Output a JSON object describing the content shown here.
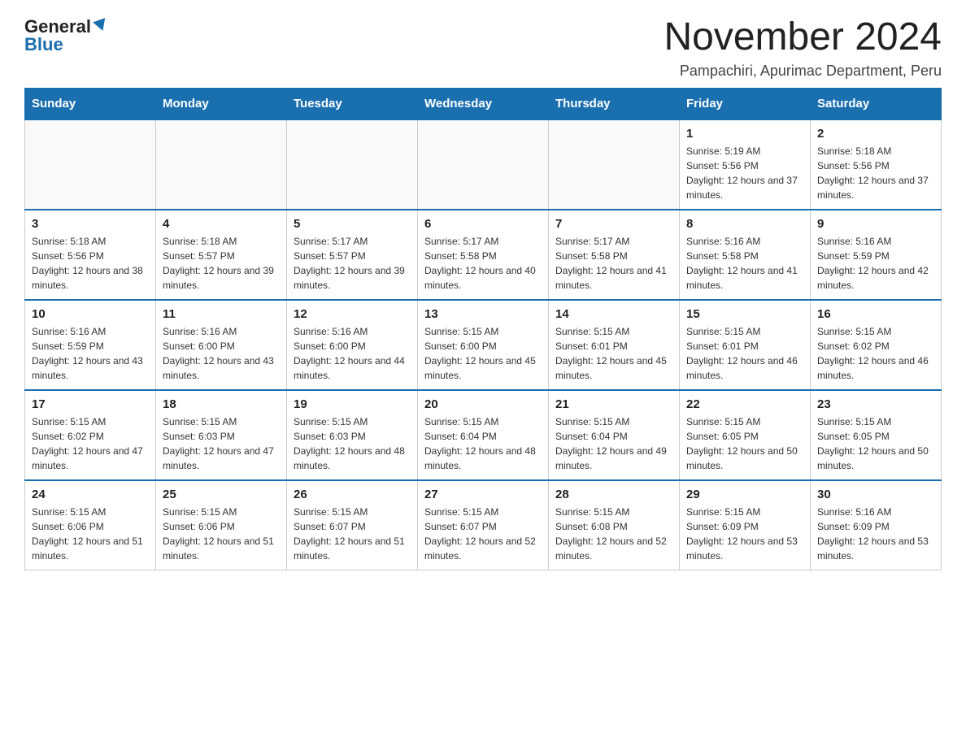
{
  "logo": {
    "general": "General",
    "blue": "Blue"
  },
  "title": "November 2024",
  "subtitle": "Pampachiri, Apurimac Department, Peru",
  "weekdays": [
    "Sunday",
    "Monday",
    "Tuesday",
    "Wednesday",
    "Thursday",
    "Friday",
    "Saturday"
  ],
  "weeks": [
    [
      {
        "day": "",
        "sunrise": "",
        "sunset": "",
        "daylight": ""
      },
      {
        "day": "",
        "sunrise": "",
        "sunset": "",
        "daylight": ""
      },
      {
        "day": "",
        "sunrise": "",
        "sunset": "",
        "daylight": ""
      },
      {
        "day": "",
        "sunrise": "",
        "sunset": "",
        "daylight": ""
      },
      {
        "day": "",
        "sunrise": "",
        "sunset": "",
        "daylight": ""
      },
      {
        "day": "1",
        "sunrise": "Sunrise: 5:19 AM",
        "sunset": "Sunset: 5:56 PM",
        "daylight": "Daylight: 12 hours and 37 minutes."
      },
      {
        "day": "2",
        "sunrise": "Sunrise: 5:18 AM",
        "sunset": "Sunset: 5:56 PM",
        "daylight": "Daylight: 12 hours and 37 minutes."
      }
    ],
    [
      {
        "day": "3",
        "sunrise": "Sunrise: 5:18 AM",
        "sunset": "Sunset: 5:56 PM",
        "daylight": "Daylight: 12 hours and 38 minutes."
      },
      {
        "day": "4",
        "sunrise": "Sunrise: 5:18 AM",
        "sunset": "Sunset: 5:57 PM",
        "daylight": "Daylight: 12 hours and 39 minutes."
      },
      {
        "day": "5",
        "sunrise": "Sunrise: 5:17 AM",
        "sunset": "Sunset: 5:57 PM",
        "daylight": "Daylight: 12 hours and 39 minutes."
      },
      {
        "day": "6",
        "sunrise": "Sunrise: 5:17 AM",
        "sunset": "Sunset: 5:58 PM",
        "daylight": "Daylight: 12 hours and 40 minutes."
      },
      {
        "day": "7",
        "sunrise": "Sunrise: 5:17 AM",
        "sunset": "Sunset: 5:58 PM",
        "daylight": "Daylight: 12 hours and 41 minutes."
      },
      {
        "day": "8",
        "sunrise": "Sunrise: 5:16 AM",
        "sunset": "Sunset: 5:58 PM",
        "daylight": "Daylight: 12 hours and 41 minutes."
      },
      {
        "day": "9",
        "sunrise": "Sunrise: 5:16 AM",
        "sunset": "Sunset: 5:59 PM",
        "daylight": "Daylight: 12 hours and 42 minutes."
      }
    ],
    [
      {
        "day": "10",
        "sunrise": "Sunrise: 5:16 AM",
        "sunset": "Sunset: 5:59 PM",
        "daylight": "Daylight: 12 hours and 43 minutes."
      },
      {
        "day": "11",
        "sunrise": "Sunrise: 5:16 AM",
        "sunset": "Sunset: 6:00 PM",
        "daylight": "Daylight: 12 hours and 43 minutes."
      },
      {
        "day": "12",
        "sunrise": "Sunrise: 5:16 AM",
        "sunset": "Sunset: 6:00 PM",
        "daylight": "Daylight: 12 hours and 44 minutes."
      },
      {
        "day": "13",
        "sunrise": "Sunrise: 5:15 AM",
        "sunset": "Sunset: 6:00 PM",
        "daylight": "Daylight: 12 hours and 45 minutes."
      },
      {
        "day": "14",
        "sunrise": "Sunrise: 5:15 AM",
        "sunset": "Sunset: 6:01 PM",
        "daylight": "Daylight: 12 hours and 45 minutes."
      },
      {
        "day": "15",
        "sunrise": "Sunrise: 5:15 AM",
        "sunset": "Sunset: 6:01 PM",
        "daylight": "Daylight: 12 hours and 46 minutes."
      },
      {
        "day": "16",
        "sunrise": "Sunrise: 5:15 AM",
        "sunset": "Sunset: 6:02 PM",
        "daylight": "Daylight: 12 hours and 46 minutes."
      }
    ],
    [
      {
        "day": "17",
        "sunrise": "Sunrise: 5:15 AM",
        "sunset": "Sunset: 6:02 PM",
        "daylight": "Daylight: 12 hours and 47 minutes."
      },
      {
        "day": "18",
        "sunrise": "Sunrise: 5:15 AM",
        "sunset": "Sunset: 6:03 PM",
        "daylight": "Daylight: 12 hours and 47 minutes."
      },
      {
        "day": "19",
        "sunrise": "Sunrise: 5:15 AM",
        "sunset": "Sunset: 6:03 PM",
        "daylight": "Daylight: 12 hours and 48 minutes."
      },
      {
        "day": "20",
        "sunrise": "Sunrise: 5:15 AM",
        "sunset": "Sunset: 6:04 PM",
        "daylight": "Daylight: 12 hours and 48 minutes."
      },
      {
        "day": "21",
        "sunrise": "Sunrise: 5:15 AM",
        "sunset": "Sunset: 6:04 PM",
        "daylight": "Daylight: 12 hours and 49 minutes."
      },
      {
        "day": "22",
        "sunrise": "Sunrise: 5:15 AM",
        "sunset": "Sunset: 6:05 PM",
        "daylight": "Daylight: 12 hours and 50 minutes."
      },
      {
        "day": "23",
        "sunrise": "Sunrise: 5:15 AM",
        "sunset": "Sunset: 6:05 PM",
        "daylight": "Daylight: 12 hours and 50 minutes."
      }
    ],
    [
      {
        "day": "24",
        "sunrise": "Sunrise: 5:15 AM",
        "sunset": "Sunset: 6:06 PM",
        "daylight": "Daylight: 12 hours and 51 minutes."
      },
      {
        "day": "25",
        "sunrise": "Sunrise: 5:15 AM",
        "sunset": "Sunset: 6:06 PM",
        "daylight": "Daylight: 12 hours and 51 minutes."
      },
      {
        "day": "26",
        "sunrise": "Sunrise: 5:15 AM",
        "sunset": "Sunset: 6:07 PM",
        "daylight": "Daylight: 12 hours and 51 minutes."
      },
      {
        "day": "27",
        "sunrise": "Sunrise: 5:15 AM",
        "sunset": "Sunset: 6:07 PM",
        "daylight": "Daylight: 12 hours and 52 minutes."
      },
      {
        "day": "28",
        "sunrise": "Sunrise: 5:15 AM",
        "sunset": "Sunset: 6:08 PM",
        "daylight": "Daylight: 12 hours and 52 minutes."
      },
      {
        "day": "29",
        "sunrise": "Sunrise: 5:15 AM",
        "sunset": "Sunset: 6:09 PM",
        "daylight": "Daylight: 12 hours and 53 minutes."
      },
      {
        "day": "30",
        "sunrise": "Sunrise: 5:16 AM",
        "sunset": "Sunset: 6:09 PM",
        "daylight": "Daylight: 12 hours and 53 minutes."
      }
    ]
  ]
}
